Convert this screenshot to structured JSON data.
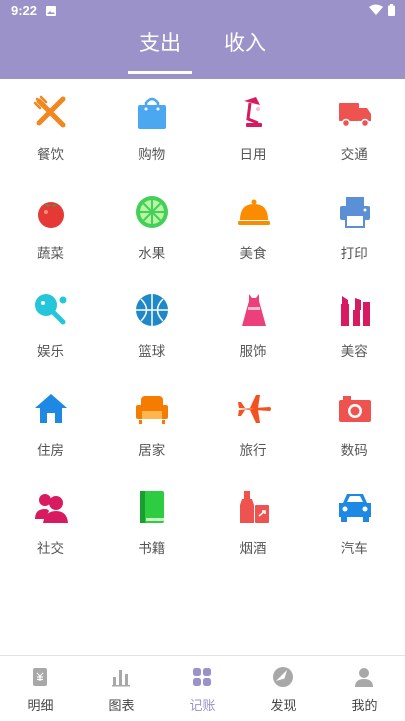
{
  "status": {
    "time": "9:22"
  },
  "tabs": {
    "expense": "支出",
    "income": "收入",
    "active": "expense"
  },
  "colors": {
    "header": "#9b92c9",
    "accent": "#9b92c9"
  },
  "categories": [
    {
      "label": "餐饮",
      "icon": "fork-knife-icon",
      "color": "#f2861f"
    },
    {
      "label": "购物",
      "icon": "shopping-bag-icon",
      "color": "#4ba7f0"
    },
    {
      "label": "日用",
      "icon": "desk-lamp-icon",
      "color": "#d81b60"
    },
    {
      "label": "交通",
      "icon": "truck-icon",
      "color": "#ef5350"
    },
    {
      "label": "蔬菜",
      "icon": "tomato-icon",
      "color": "#e53935"
    },
    {
      "label": "水果",
      "icon": "lime-icon",
      "color": "#43d05a"
    },
    {
      "label": "美食",
      "icon": "food-cloche-icon",
      "color": "#fb8c00"
    },
    {
      "label": "打印",
      "icon": "printer-icon",
      "color": "#5b8fd6"
    },
    {
      "label": "娱乐",
      "icon": "ping-pong-icon",
      "color": "#26c6da"
    },
    {
      "label": "篮球",
      "icon": "basketball-icon",
      "color": "#1e88c8"
    },
    {
      "label": "服饰",
      "icon": "dress-icon",
      "color": "#ec407a"
    },
    {
      "label": "美容",
      "icon": "cosmetics-icon",
      "color": "#d81b60"
    },
    {
      "label": "住房",
      "icon": "house-icon",
      "color": "#1e88e5"
    },
    {
      "label": "居家",
      "icon": "armchair-icon",
      "color": "#f57c00"
    },
    {
      "label": "旅行",
      "icon": "airplane-icon",
      "color": "#f4511e"
    },
    {
      "label": "数码",
      "icon": "camera-icon",
      "color": "#ef5350"
    },
    {
      "label": "社交",
      "icon": "users-icon",
      "color": "#d81b60"
    },
    {
      "label": "书籍",
      "icon": "book-icon",
      "color": "#2ecc40"
    },
    {
      "label": "烟酒",
      "icon": "bottle-icon",
      "color": "#ef5350"
    },
    {
      "label": "汽车",
      "icon": "car-icon",
      "color": "#1e88e5"
    }
  ],
  "nav": [
    {
      "label": "明细",
      "icon": "ledger-icon",
      "active": false
    },
    {
      "label": "图表",
      "icon": "bar-chart-icon",
      "active": false
    },
    {
      "label": "记账",
      "icon": "grid-icon",
      "active": true
    },
    {
      "label": "发现",
      "icon": "compass-icon",
      "active": false
    },
    {
      "label": "我的",
      "icon": "person-icon",
      "active": false
    }
  ]
}
